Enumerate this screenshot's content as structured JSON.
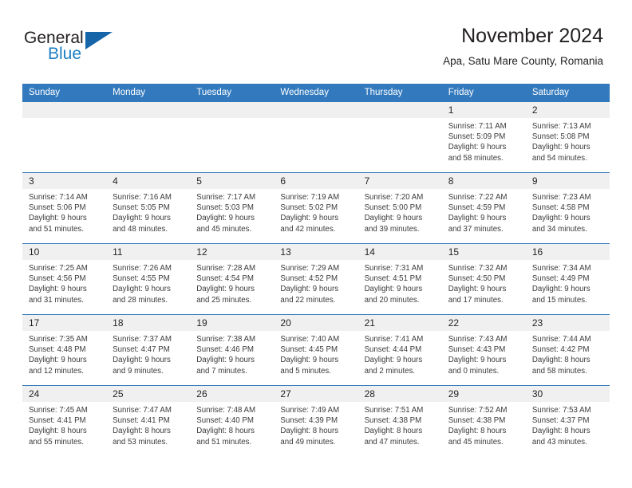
{
  "logo": {
    "word1": "General",
    "word2": "Blue",
    "triangle_color": "#1565a8",
    "blue_color": "#1c7fc4"
  },
  "header": {
    "month_title": "November 2024",
    "location": "Apa, Satu Mare County, Romania"
  },
  "theme": {
    "header_bg": "#3279bd",
    "header_text": "#ffffff",
    "daynum_band_bg": "#f0f0f0",
    "row_border": "#3279bd",
    "body_text": "#3b3b3b"
  },
  "weekday_headers": [
    "Sunday",
    "Monday",
    "Tuesday",
    "Wednesday",
    "Thursday",
    "Friday",
    "Saturday"
  ],
  "labels": {
    "sunrise_prefix": "Sunrise:",
    "sunset_prefix": "Sunset:",
    "daylight_prefix": "Daylight:"
  },
  "weeks": [
    [
      {
        "day": "",
        "empty": true
      },
      {
        "day": "",
        "empty": true
      },
      {
        "day": "",
        "empty": true
      },
      {
        "day": "",
        "empty": true
      },
      {
        "day": "",
        "empty": true
      },
      {
        "day": "1",
        "sunrise": "Sunrise: 7:11 AM",
        "sunset": "Sunset: 5:09 PM",
        "daylight_l1": "Daylight: 9 hours",
        "daylight_l2": "and 58 minutes."
      },
      {
        "day": "2",
        "sunrise": "Sunrise: 7:13 AM",
        "sunset": "Sunset: 5:08 PM",
        "daylight_l1": "Daylight: 9 hours",
        "daylight_l2": "and 54 minutes."
      }
    ],
    [
      {
        "day": "3",
        "sunrise": "Sunrise: 7:14 AM",
        "sunset": "Sunset: 5:06 PM",
        "daylight_l1": "Daylight: 9 hours",
        "daylight_l2": "and 51 minutes."
      },
      {
        "day": "4",
        "sunrise": "Sunrise: 7:16 AM",
        "sunset": "Sunset: 5:05 PM",
        "daylight_l1": "Daylight: 9 hours",
        "daylight_l2": "and 48 minutes."
      },
      {
        "day": "5",
        "sunrise": "Sunrise: 7:17 AM",
        "sunset": "Sunset: 5:03 PM",
        "daylight_l1": "Daylight: 9 hours",
        "daylight_l2": "and 45 minutes."
      },
      {
        "day": "6",
        "sunrise": "Sunrise: 7:19 AM",
        "sunset": "Sunset: 5:02 PM",
        "daylight_l1": "Daylight: 9 hours",
        "daylight_l2": "and 42 minutes."
      },
      {
        "day": "7",
        "sunrise": "Sunrise: 7:20 AM",
        "sunset": "Sunset: 5:00 PM",
        "daylight_l1": "Daylight: 9 hours",
        "daylight_l2": "and 39 minutes."
      },
      {
        "day": "8",
        "sunrise": "Sunrise: 7:22 AM",
        "sunset": "Sunset: 4:59 PM",
        "daylight_l1": "Daylight: 9 hours",
        "daylight_l2": "and 37 minutes."
      },
      {
        "day": "9",
        "sunrise": "Sunrise: 7:23 AM",
        "sunset": "Sunset: 4:58 PM",
        "daylight_l1": "Daylight: 9 hours",
        "daylight_l2": "and 34 minutes."
      }
    ],
    [
      {
        "day": "10",
        "sunrise": "Sunrise: 7:25 AM",
        "sunset": "Sunset: 4:56 PM",
        "daylight_l1": "Daylight: 9 hours",
        "daylight_l2": "and 31 minutes."
      },
      {
        "day": "11",
        "sunrise": "Sunrise: 7:26 AM",
        "sunset": "Sunset: 4:55 PM",
        "daylight_l1": "Daylight: 9 hours",
        "daylight_l2": "and 28 minutes."
      },
      {
        "day": "12",
        "sunrise": "Sunrise: 7:28 AM",
        "sunset": "Sunset: 4:54 PM",
        "daylight_l1": "Daylight: 9 hours",
        "daylight_l2": "and 25 minutes."
      },
      {
        "day": "13",
        "sunrise": "Sunrise: 7:29 AM",
        "sunset": "Sunset: 4:52 PM",
        "daylight_l1": "Daylight: 9 hours",
        "daylight_l2": "and 22 minutes."
      },
      {
        "day": "14",
        "sunrise": "Sunrise: 7:31 AM",
        "sunset": "Sunset: 4:51 PM",
        "daylight_l1": "Daylight: 9 hours",
        "daylight_l2": "and 20 minutes."
      },
      {
        "day": "15",
        "sunrise": "Sunrise: 7:32 AM",
        "sunset": "Sunset: 4:50 PM",
        "daylight_l1": "Daylight: 9 hours",
        "daylight_l2": "and 17 minutes."
      },
      {
        "day": "16",
        "sunrise": "Sunrise: 7:34 AM",
        "sunset": "Sunset: 4:49 PM",
        "daylight_l1": "Daylight: 9 hours",
        "daylight_l2": "and 15 minutes."
      }
    ],
    [
      {
        "day": "17",
        "sunrise": "Sunrise: 7:35 AM",
        "sunset": "Sunset: 4:48 PM",
        "daylight_l1": "Daylight: 9 hours",
        "daylight_l2": "and 12 minutes."
      },
      {
        "day": "18",
        "sunrise": "Sunrise: 7:37 AM",
        "sunset": "Sunset: 4:47 PM",
        "daylight_l1": "Daylight: 9 hours",
        "daylight_l2": "and 9 minutes."
      },
      {
        "day": "19",
        "sunrise": "Sunrise: 7:38 AM",
        "sunset": "Sunset: 4:46 PM",
        "daylight_l1": "Daylight: 9 hours",
        "daylight_l2": "and 7 minutes."
      },
      {
        "day": "20",
        "sunrise": "Sunrise: 7:40 AM",
        "sunset": "Sunset: 4:45 PM",
        "daylight_l1": "Daylight: 9 hours",
        "daylight_l2": "and 5 minutes."
      },
      {
        "day": "21",
        "sunrise": "Sunrise: 7:41 AM",
        "sunset": "Sunset: 4:44 PM",
        "daylight_l1": "Daylight: 9 hours",
        "daylight_l2": "and 2 minutes."
      },
      {
        "day": "22",
        "sunrise": "Sunrise: 7:43 AM",
        "sunset": "Sunset: 4:43 PM",
        "daylight_l1": "Daylight: 9 hours",
        "daylight_l2": "and 0 minutes."
      },
      {
        "day": "23",
        "sunrise": "Sunrise: 7:44 AM",
        "sunset": "Sunset: 4:42 PM",
        "daylight_l1": "Daylight: 8 hours",
        "daylight_l2": "and 58 minutes."
      }
    ],
    [
      {
        "day": "24",
        "sunrise": "Sunrise: 7:45 AM",
        "sunset": "Sunset: 4:41 PM",
        "daylight_l1": "Daylight: 8 hours",
        "daylight_l2": "and 55 minutes."
      },
      {
        "day": "25",
        "sunrise": "Sunrise: 7:47 AM",
        "sunset": "Sunset: 4:41 PM",
        "daylight_l1": "Daylight: 8 hours",
        "daylight_l2": "and 53 minutes."
      },
      {
        "day": "26",
        "sunrise": "Sunrise: 7:48 AM",
        "sunset": "Sunset: 4:40 PM",
        "daylight_l1": "Daylight: 8 hours",
        "daylight_l2": "and 51 minutes."
      },
      {
        "day": "27",
        "sunrise": "Sunrise: 7:49 AM",
        "sunset": "Sunset: 4:39 PM",
        "daylight_l1": "Daylight: 8 hours",
        "daylight_l2": "and 49 minutes."
      },
      {
        "day": "28",
        "sunrise": "Sunrise: 7:51 AM",
        "sunset": "Sunset: 4:38 PM",
        "daylight_l1": "Daylight: 8 hours",
        "daylight_l2": "and 47 minutes."
      },
      {
        "day": "29",
        "sunrise": "Sunrise: 7:52 AM",
        "sunset": "Sunset: 4:38 PM",
        "daylight_l1": "Daylight: 8 hours",
        "daylight_l2": "and 45 minutes."
      },
      {
        "day": "30",
        "sunrise": "Sunrise: 7:53 AM",
        "sunset": "Sunset: 4:37 PM",
        "daylight_l1": "Daylight: 8 hours",
        "daylight_l2": "and 43 minutes."
      }
    ]
  ]
}
